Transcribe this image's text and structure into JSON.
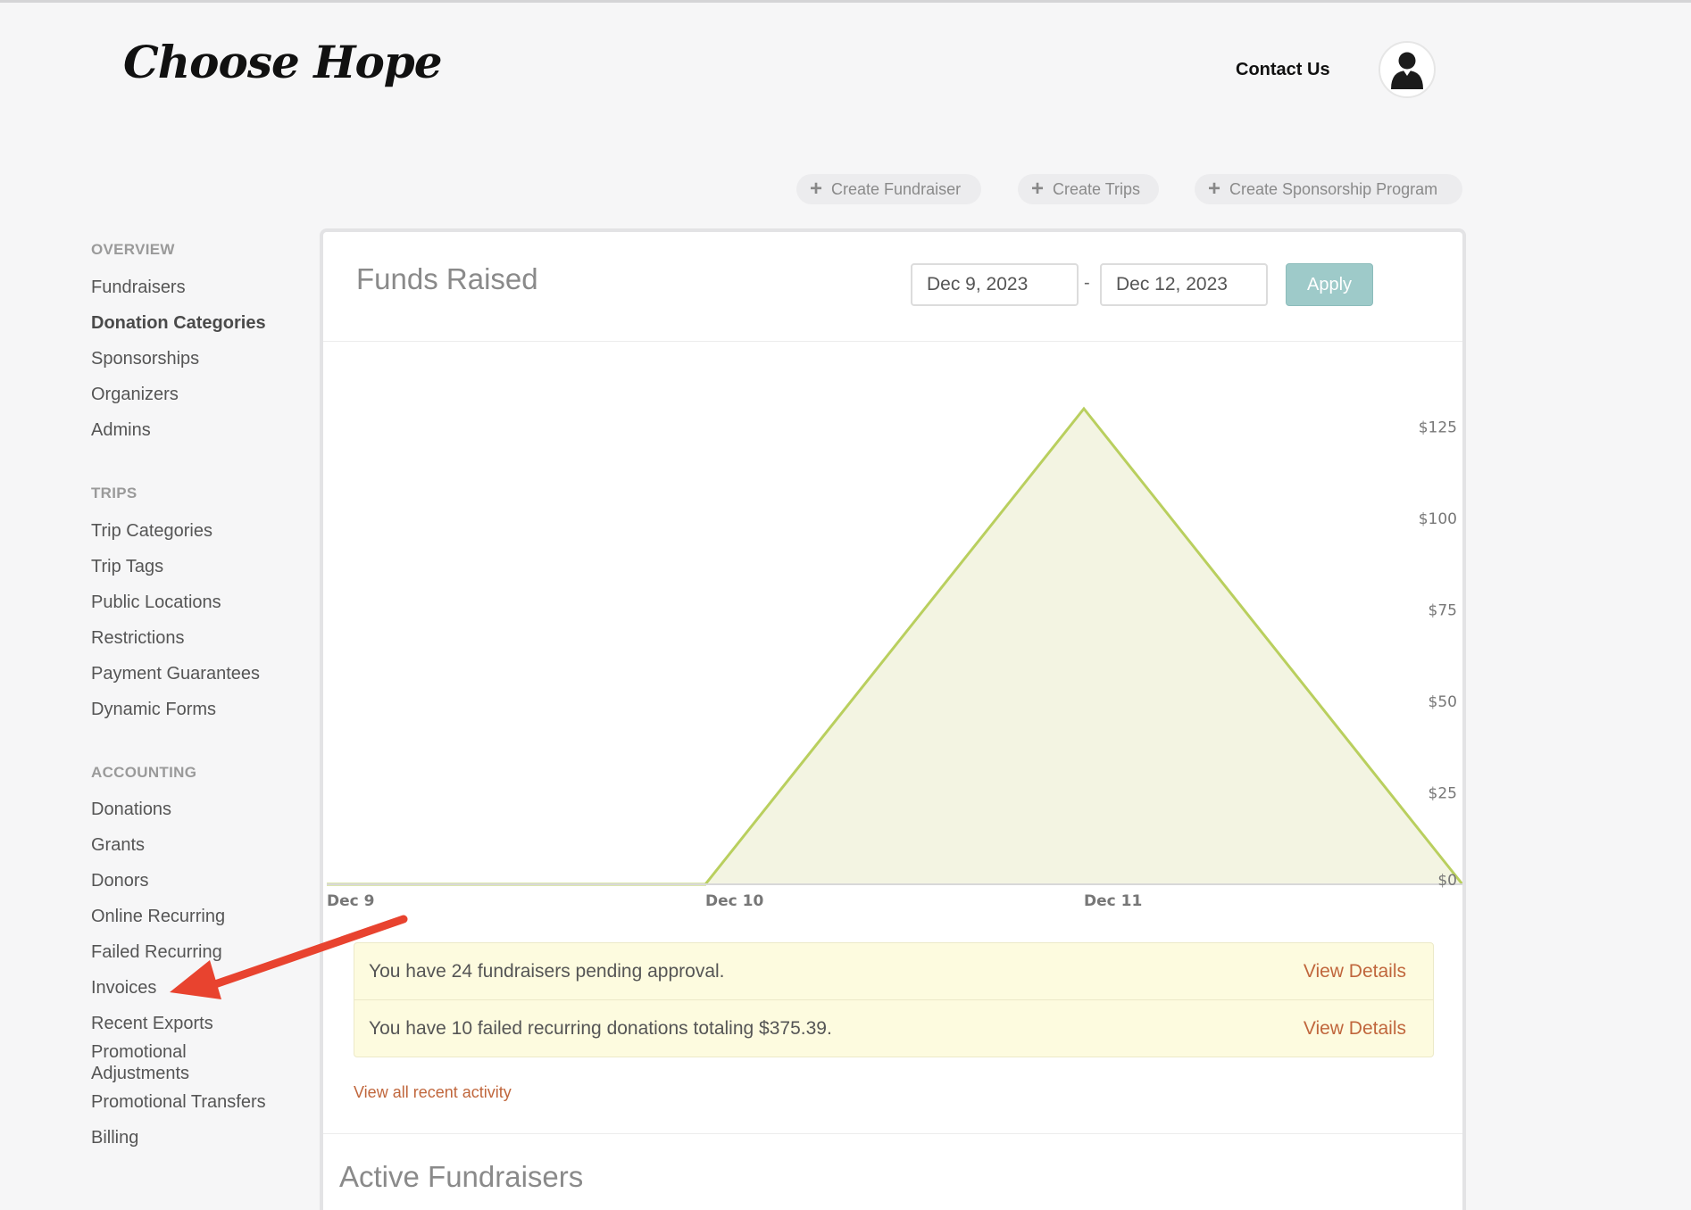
{
  "header": {
    "logo_text": "Choose Hope",
    "contact_label": "Contact Us",
    "avatar_icon": "user-avatar-icon"
  },
  "actions": [
    {
      "label": "Create Fundraiser",
      "icon": "plus-icon"
    },
    {
      "label": "Create Trips",
      "icon": "plus-icon"
    },
    {
      "label": "Create Sponsorship Program",
      "icon": "plus-icon"
    }
  ],
  "sidebar": {
    "sections": [
      {
        "title": "OVERVIEW",
        "items": [
          "Fundraisers",
          "Donation Categories",
          "Sponsorships",
          "Organizers",
          "Admins"
        ],
        "active": "Donation Categories"
      },
      {
        "title": "TRIPS",
        "items": [
          "Trip Categories",
          "Trip Tags",
          "Public Locations",
          "Restrictions",
          "Payment Guarantees",
          "Dynamic Forms"
        ]
      },
      {
        "title": "ACCOUNTING",
        "items": [
          "Donations",
          "Grants",
          "Donors",
          "Online Recurring",
          "Failed Recurring",
          "Invoices",
          "Recent Exports",
          "Promotional Adjustments",
          "Promotional Transfers",
          "Billing"
        ]
      }
    ]
  },
  "funds": {
    "title": "Funds Raised",
    "date_from": "Dec 9, 2023",
    "date_separator": "-",
    "date_to": "Dec 12, 2023",
    "apply_label": "Apply"
  },
  "chart_data": {
    "type": "area",
    "x": [
      "Dec 9",
      "Dec 10",
      "Dec 11",
      "Dec 12"
    ],
    "tick_labels": [
      "Dec 9",
      "Dec 10",
      "Dec 11"
    ],
    "values": [
      0,
      0,
      130,
      0
    ],
    "y_ticks": [
      "$125",
      "$100",
      "$75",
      "$50",
      "$25",
      "$0"
    ],
    "ylim": [
      0,
      130
    ],
    "grid": false,
    "colors": {
      "line": "#b9cf5e",
      "fill": "#f3f4e2"
    }
  },
  "alerts": [
    {
      "text": "You have 24 fundraisers pending approval.",
      "link": "View Details"
    },
    {
      "text": "You have 10 failed recurring donations totaling $375.39.",
      "link": "View Details"
    }
  ],
  "recent_activity_link": "View all recent activity",
  "active_fundraisers_title": "Active Fundraisers",
  "colors": {
    "link": "#c0663c",
    "apply_button": "#9ecac9",
    "alert_bg": "#fdfbdf",
    "annotation_arrow": "#e8432f"
  }
}
